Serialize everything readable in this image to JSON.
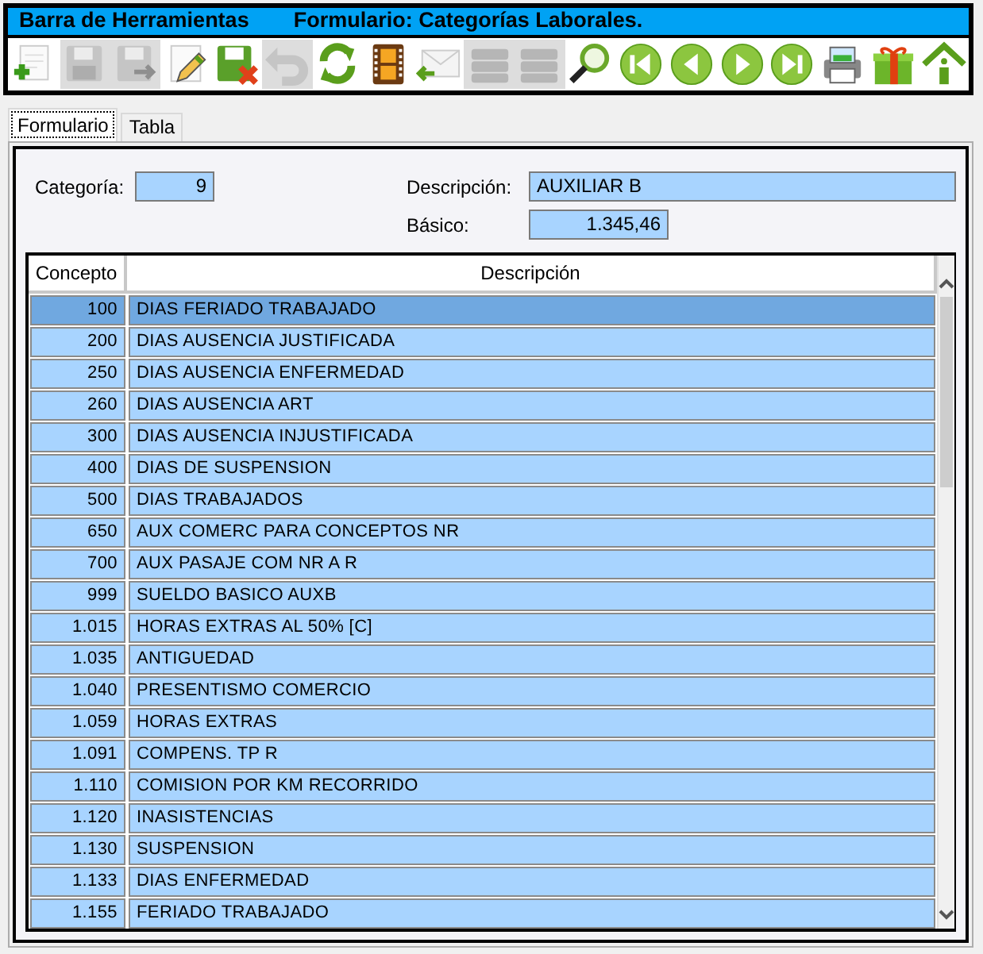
{
  "window": {
    "title": "Barra de Herramientas",
    "subtitle": "Formulario: Categorías Laborales."
  },
  "toolbar": [
    {
      "kind": "add",
      "disabled": false
    },
    {
      "kind": "save",
      "disabled": true
    },
    {
      "kind": "save-as",
      "disabled": true
    },
    {
      "kind": "edit",
      "disabled": false
    },
    {
      "kind": "save-cancel",
      "disabled": false
    },
    {
      "kind": "undo",
      "disabled": true
    },
    {
      "kind": "refresh",
      "disabled": false
    },
    {
      "kind": "film",
      "disabled": false
    },
    {
      "kind": "mail",
      "disabled": false
    },
    {
      "kind": "list",
      "disabled": true
    },
    {
      "kind": "list",
      "disabled": true
    },
    {
      "kind": "search",
      "disabled": false
    },
    {
      "kind": "first",
      "disabled": false
    },
    {
      "kind": "prev",
      "disabled": false
    },
    {
      "kind": "next",
      "disabled": false
    },
    {
      "kind": "last",
      "disabled": false
    },
    {
      "kind": "print",
      "disabled": false
    },
    {
      "kind": "gift",
      "disabled": false
    },
    {
      "kind": "home",
      "disabled": false
    }
  ],
  "tabs": [
    {
      "label": "Formulario",
      "selected": true
    },
    {
      "label": "Tabla",
      "selected": false
    }
  ],
  "form": {
    "categoria_label": "Categoría:",
    "categoria": "9",
    "descripcion_label": "Descripción:",
    "descripcion": "AUXILIAR B",
    "basico_label": "Básico:",
    "basico": "1.345,46"
  },
  "table": {
    "columns": [
      "Concepto",
      "Descripción"
    ],
    "rows": [
      {
        "concepto": "100",
        "descripcion": "DIAS FERIADO TRABAJADO",
        "selected": true
      },
      {
        "concepto": "200",
        "descripcion": "DIAS AUSENCIA JUSTIFICADA",
        "selected": false
      },
      {
        "concepto": "250",
        "descripcion": "DIAS AUSENCIA ENFERMEDAD",
        "selected": false
      },
      {
        "concepto": "260",
        "descripcion": "DIAS AUSENCIA ART",
        "selected": false
      },
      {
        "concepto": "300",
        "descripcion": "DIAS AUSENCIA INJUSTIFICADA",
        "selected": false
      },
      {
        "concepto": "400",
        "descripcion": "DIAS DE SUSPENSION",
        "selected": false
      },
      {
        "concepto": "500",
        "descripcion": "DIAS  TRABAJADOS",
        "selected": false
      },
      {
        "concepto": "650",
        "descripcion": "AUX COMERC PARA CONCEPTOS NR",
        "selected": false
      },
      {
        "concepto": "700",
        "descripcion": "AUX PASAJE COM NR A R",
        "selected": false
      },
      {
        "concepto": "999",
        "descripcion": "SUELDO BASICO AUXB",
        "selected": false
      },
      {
        "concepto": "1.015",
        "descripcion": "HORAS EXTRAS AL 50% [C]",
        "selected": false
      },
      {
        "concepto": "1.035",
        "descripcion": "ANTIGUEDAD",
        "selected": false
      },
      {
        "concepto": "1.040",
        "descripcion": "PRESENTISMO COMERCIO",
        "selected": false
      },
      {
        "concepto": "1.059",
        "descripcion": "HORAS EXTRAS",
        "selected": false
      },
      {
        "concepto": "1.091",
        "descripcion": "COMPENS. TP R",
        "selected": false
      },
      {
        "concepto": "1.110",
        "descripcion": "COMISION POR KM RECORRIDO",
        "selected": false
      },
      {
        "concepto": "1.120",
        "descripcion": "INASISTENCIAS",
        "selected": false
      },
      {
        "concepto": "1.130",
        "descripcion": "SUSPENSION",
        "selected": false
      },
      {
        "concepto": "1.133",
        "descripcion": "DIAS ENFERMEDAD",
        "selected": false
      },
      {
        "concepto": "1.155",
        "descripcion": "FERIADO TRABAJADO",
        "selected": false
      }
    ]
  }
}
